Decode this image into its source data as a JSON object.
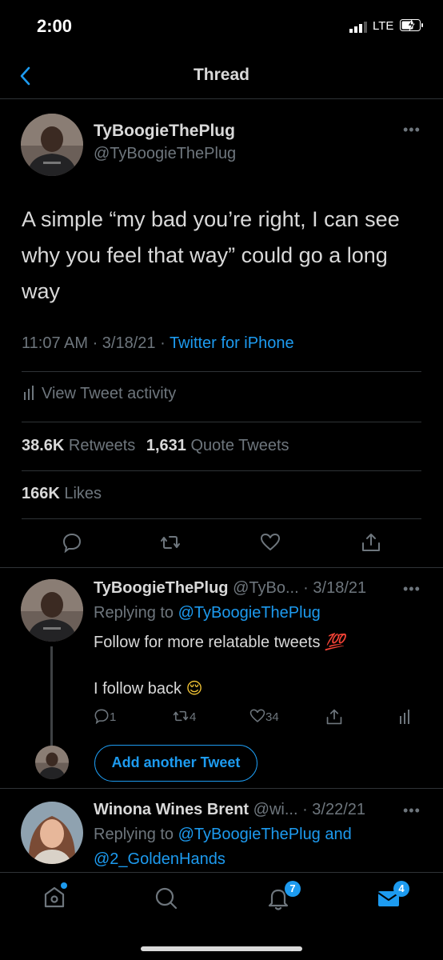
{
  "status_bar": {
    "time": "2:00",
    "network": "LTE"
  },
  "nav": {
    "title": "Thread"
  },
  "main_tweet": {
    "name": "TyBoogieThePlug",
    "handle": "@TyBoogieThePlug",
    "text": "A simple “my bad you’re right, I can see why you feel that way” could go a long way",
    "time": "11:07 AM · 3/18/21 · ",
    "source": "Twitter for iPhone",
    "activity": "View Tweet activity",
    "retweets_count": "38.6K",
    "retweets_label": " Retweets",
    "quotes_count": "1,631",
    "quotes_label": " Quote Tweets",
    "likes_count": "166K",
    "likes_label": " Likes"
  },
  "reply1": {
    "name": "TyBoogieThePlug",
    "handle_date": " @TyBo... · 3/18/21",
    "replying_prefix": "Replying to ",
    "replying_to": "@TyBoogieThePlug",
    "line1": "Follow for more relatable tweets ",
    "emoji1": "💯",
    "line2": "I follow back ",
    "emoji2": "😌",
    "replies": "1",
    "retweets": "4",
    "likes": "34"
  },
  "add_tweet": {
    "label": "Add another Tweet"
  },
  "reply2": {
    "name": "Winona Wines Brent",
    "handle_date": " @wi... · 3/22/21",
    "replying_prefix": "Replying to ",
    "replying_to": "@TyBoogieThePlug and",
    "replying_to2": "@2_GoldenHands"
  },
  "tabbar": {
    "notifications_badge": "7",
    "messages_badge": "4"
  },
  "colors": {
    "background": "#000000",
    "accent": "#1d9bf0",
    "text": "#d9d9d9",
    "secondary": "#6e767d",
    "divider": "#2f3336"
  }
}
